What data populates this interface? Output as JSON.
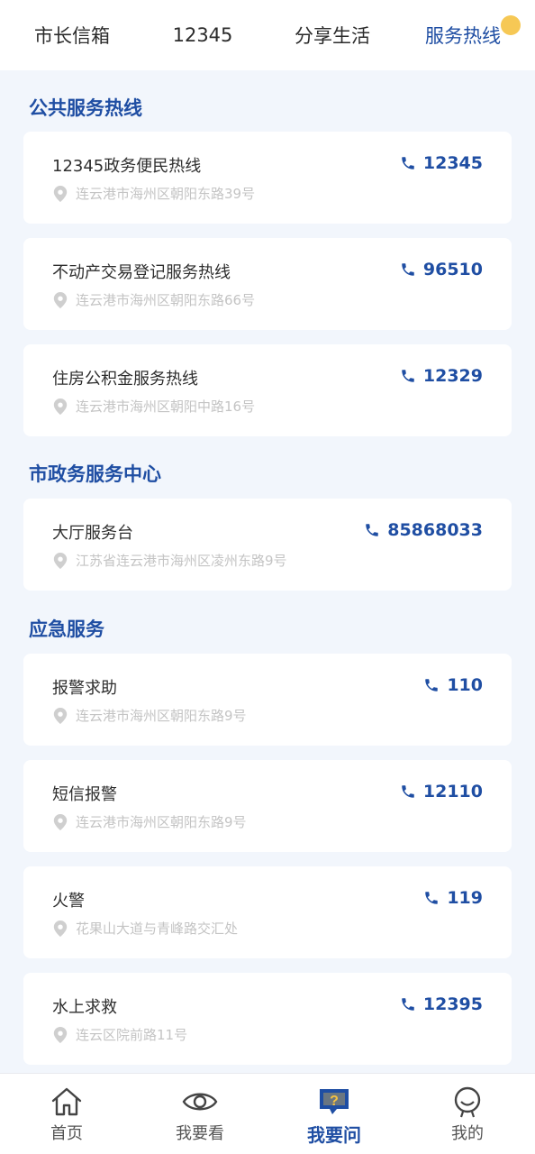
{
  "top_tabs": [
    {
      "label": "市长信箱"
    },
    {
      "label": "12345"
    },
    {
      "label": "分享生活"
    },
    {
      "label": "服务热线",
      "active": true
    }
  ],
  "sections": [
    {
      "title": "公共服务热线",
      "items": [
        {
          "name": "12345政务便民热线",
          "phone": "12345",
          "address": "连云港市海州区朝阳东路39号"
        },
        {
          "name": "不动产交易登记服务热线",
          "phone": "96510",
          "address": "连云港市海州区朝阳东路66号"
        },
        {
          "name": "住房公积金服务热线",
          "phone": "12329",
          "address": "连云港市海州区朝阳中路16号"
        }
      ]
    },
    {
      "title": "市政务服务中心",
      "items": [
        {
          "name": "大厅服务台",
          "phone": "85868033",
          "address": "江苏省连云港市海州区凌州东路9号"
        }
      ]
    },
    {
      "title": "应急服务",
      "items": [
        {
          "name": "报警求助",
          "phone": "110",
          "address": "连云港市海州区朝阳东路9号"
        },
        {
          "name": "短信报警",
          "phone": "12110",
          "address": "连云港市海州区朝阳东路9号"
        },
        {
          "name": "火警",
          "phone": "119",
          "address": "花果山大道与青峰路交汇处"
        },
        {
          "name": "水上求救",
          "phone": "12395",
          "address": "连云区院前路11号"
        }
      ]
    }
  ],
  "bottom_nav": [
    {
      "label": "首页",
      "icon": "home-icon"
    },
    {
      "label": "我要看",
      "icon": "eye-icon"
    },
    {
      "label": "我要问",
      "icon": "question-chat-icon",
      "active": true
    },
    {
      "label": "我的",
      "icon": "profile-icon"
    }
  ],
  "colors": {
    "accent": "#1f4ea3",
    "background": "#f2f6fc",
    "card": "#ffffff",
    "muted": "#c4c4c4",
    "badge": "#f5c242"
  }
}
